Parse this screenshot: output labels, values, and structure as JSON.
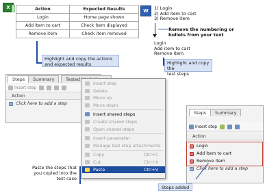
{
  "excel": {
    "badge": "X",
    "headers": [
      "Action",
      "Expected Results"
    ],
    "rows": [
      [
        "Login",
        "Home page shown"
      ],
      [
        "Add item to cart",
        "Check item displayed"
      ],
      [
        "Remove item",
        "Check item removed"
      ]
    ]
  },
  "callouts": {
    "excel_copy": "Highlight and copy the actions\nand expected results",
    "word_remove": "Remove the numbering or\nbullets from your text",
    "word_copy": "Highlight and copy the\ntest steps",
    "paste_steps": "Paste the steps that\nyou copied into the\ntest case",
    "steps_added": "Steps added"
  },
  "word": {
    "badge": "W",
    "numbered": [
      "1) Login",
      "2) Add item to cart",
      "3) Remove item"
    ],
    "plain": [
      "Login",
      "Add item to cart",
      "Remove item"
    ]
  },
  "left_panel": {
    "tabs": [
      "Steps",
      "Summary",
      "Tested Work Items"
    ],
    "toolbar_insert": "Insert step",
    "grid_header": "Action",
    "add_row": "Click here to add a step"
  },
  "context_menu": {
    "items": [
      {
        "label": "Insert step",
        "shortcut": "",
        "enabled": false,
        "icon": "insert-step-icon"
      },
      {
        "label": "Delete",
        "shortcut": "",
        "enabled": false,
        "icon": "delete-icon"
      },
      {
        "label": "Move up",
        "shortcut": "",
        "enabled": false,
        "icon": "move-up-icon"
      },
      {
        "label": "Move down",
        "shortcut": "",
        "enabled": false,
        "icon": "move-down-icon"
      },
      {
        "label": "Insert shared steps",
        "shortcut": "",
        "enabled": true,
        "icon": "insert-shared-steps-icon"
      },
      {
        "label": "Create shared steps",
        "shortcut": "",
        "enabled": false,
        "icon": "create-shared-steps-icon"
      },
      {
        "label": "Open shared steps",
        "shortcut": "",
        "enabled": false,
        "icon": "open-shared-steps-icon"
      },
      {
        "label": "Insert parameter",
        "shortcut": "",
        "enabled": false,
        "icon": "insert-parameter-icon"
      },
      {
        "label": "Manage test step attachments",
        "shortcut": "",
        "enabled": false,
        "icon": "attachment-icon"
      },
      {
        "label": "Copy",
        "shortcut": "Ctrl+C",
        "enabled": false,
        "icon": "copy-icon"
      },
      {
        "label": "Cut",
        "shortcut": "Ctrl+X",
        "enabled": false,
        "icon": "cut-icon"
      },
      {
        "label": "Paste",
        "shortcut": "Ctrl+V",
        "enabled": true,
        "selected": true,
        "icon": "paste-icon"
      }
    ]
  },
  "right_panel": {
    "tabs": [
      "Steps",
      "Summary"
    ],
    "toolbar_insert": "Insert step",
    "grid_header": "Action",
    "rows": [
      "Login",
      "Add item to cart",
      "Remove item"
    ],
    "add_row": "Click here to add a step"
  },
  "colors": {
    "callout_fill": "#d8e3f5",
    "callout_line": "#1f4e9e",
    "highlight_box": "#c0392b",
    "menu_selected": "#1f4e9e"
  }
}
